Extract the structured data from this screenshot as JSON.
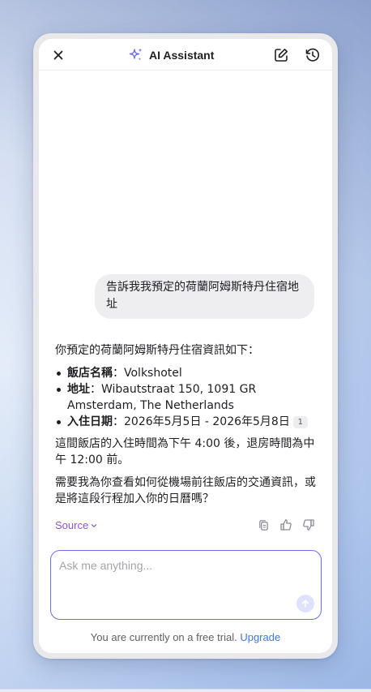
{
  "header": {
    "title": "AI Assistant",
    "close_icon": "close-icon",
    "sparkle_icon": "sparkle-icon",
    "new_chat_icon": "edit-icon",
    "history_icon": "history-icon"
  },
  "conversation": {
    "user_message": "告訴我我預定的荷蘭阿姆斯特丹住宿地址",
    "answer": {
      "intro": "你預定的荷蘭阿姆斯特丹住宿資訊如下：",
      "items": [
        {
          "key": "飯店名稱",
          "sep": "：",
          "value": "Volkshotel"
        },
        {
          "key": "地址",
          "sep": "：",
          "value": "Wibautstraat 150, 1091 GR Amsterdam, The Netherlands"
        },
        {
          "key": "入住日期",
          "sep": "：",
          "value": "2026年5月5日 - 2026年5月8日",
          "badge": "1"
        }
      ],
      "paragraph_1": "這間飯店的入住時間為下午 4:00 後，退房時間為中午 12:00 前。",
      "paragraph_2": "需要我為你查看如何從機場前往飯店的交通資訊，或是將這段行程加入你的日曆嗎？"
    },
    "source_label": "Source",
    "actions": [
      "copy-icon",
      "thumbs-up-icon",
      "thumbs-down-icon"
    ]
  },
  "input": {
    "placeholder": "Ask me anything...",
    "value": ""
  },
  "footer": {
    "trial_text": "You are currently on a free trial.",
    "upgrade_label": "Upgrade"
  },
  "colors": {
    "accent": "#6d6fe6",
    "source": "#8a55d8",
    "link": "#3f76e0",
    "bubble": "#eeeef1"
  }
}
